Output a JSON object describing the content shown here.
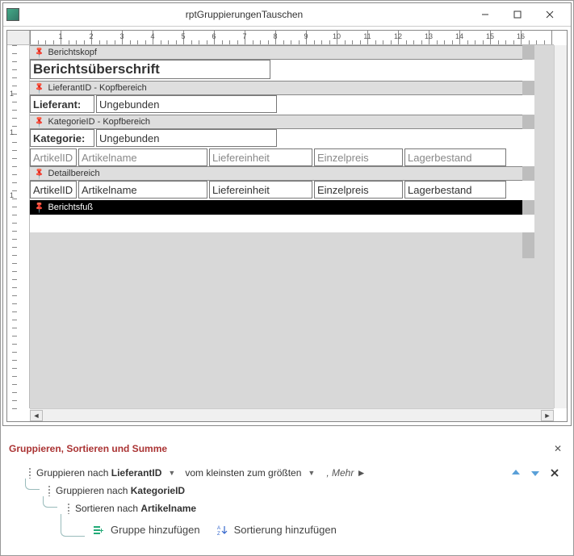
{
  "window": {
    "title": "rptGruppierungenTauschen"
  },
  "sections": {
    "report_header_label": "Berichtskopf",
    "report_title_value": "Berichtsüberschrift",
    "group1_header_label": "LieferantID - Kopfbereich",
    "group1_caption": "Lieferant:",
    "group1_value": "Ungebunden",
    "group2_header_label": "KategorieID - Kopfbereich",
    "group2_caption": "Kategorie:",
    "group2_value": "Ungebunden",
    "columns": [
      "ArtikelID",
      "Artikelname",
      "Liefereinheit",
      "Einzelpreis",
      "Lagerbestand"
    ],
    "detail_label": "Detailbereich",
    "detail_fields": [
      "ArtikelID",
      "Artikelname",
      "Liefereinheit",
      "Einzelpreis",
      "Lagerbestand"
    ],
    "report_footer_label": "Berichtsfuß"
  },
  "bottom_pane": {
    "title": "Gruppieren, Sortieren und Summe",
    "level1_prefix": "Gruppieren nach",
    "level1_field": "LieferantID",
    "level1_sort": "vom kleinsten zum größten",
    "level1_more": "Mehr",
    "level2_prefix": "Gruppieren nach",
    "level2_field": "KategorieID",
    "level3_prefix": "Sortieren nach",
    "level3_field": "Artikelname",
    "add_group": "Gruppe hinzufügen",
    "add_sort": "Sortierung hinzufügen"
  },
  "ruler_labels": [
    "1",
    "2",
    "3",
    "4",
    "5",
    "6",
    "7",
    "8",
    "9",
    "10",
    "11",
    "12",
    "13",
    "14",
    "15",
    "16"
  ]
}
